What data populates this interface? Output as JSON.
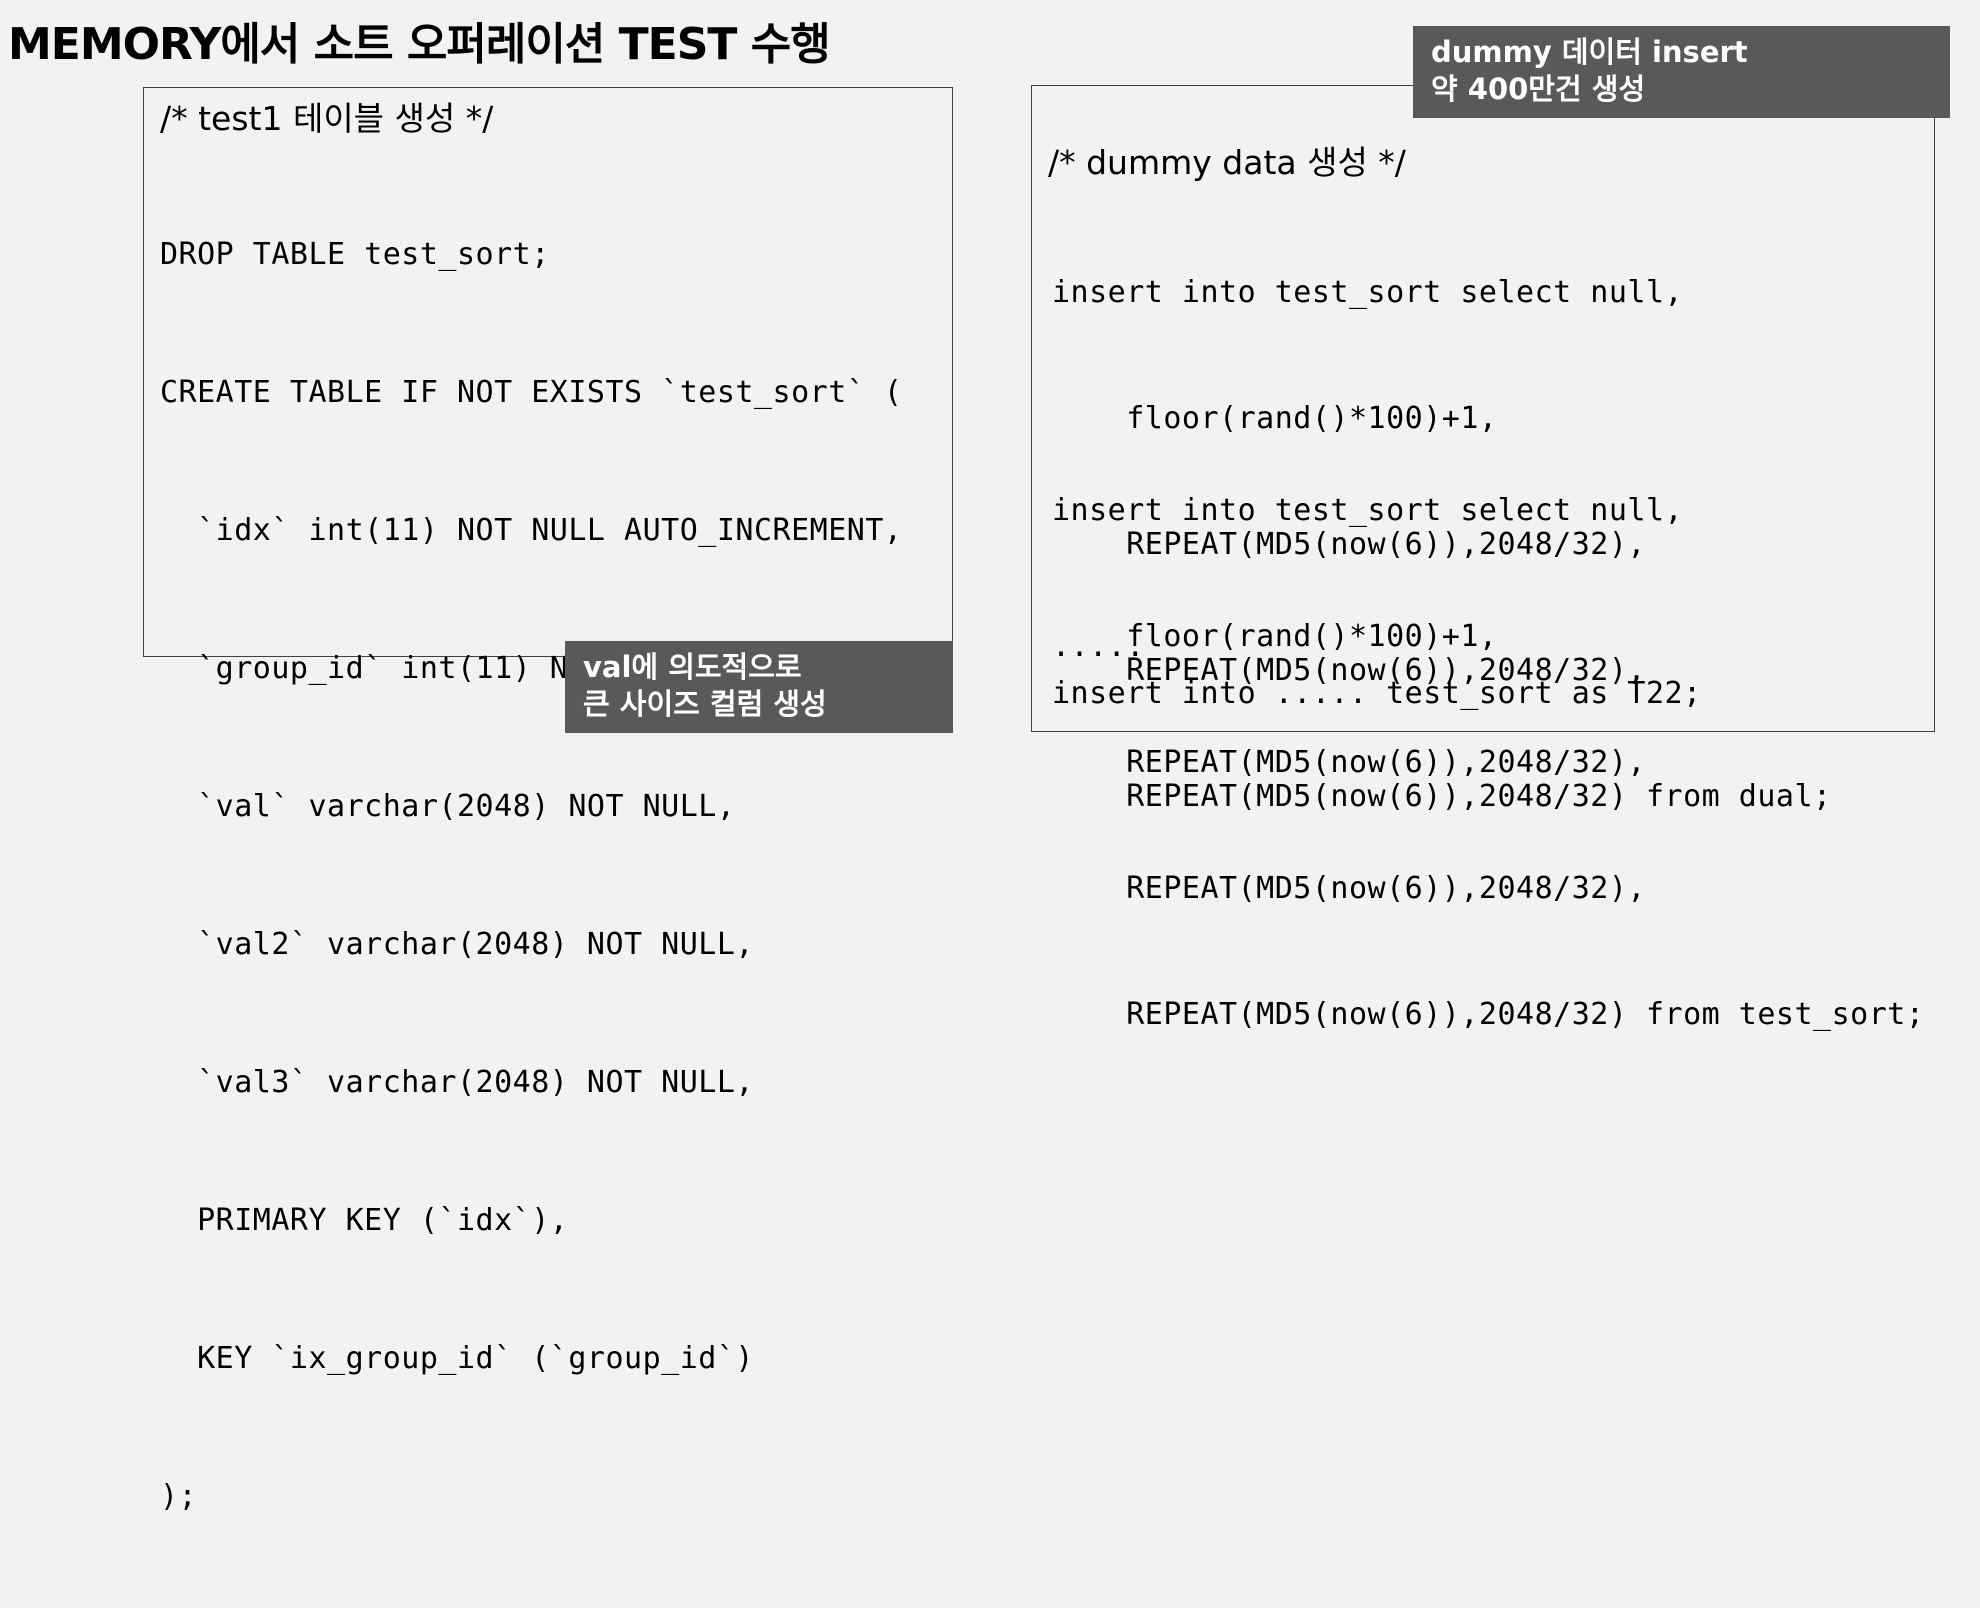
{
  "title": "MEMORY에서 소트 오퍼레이션 TEST 수행",
  "left": {
    "comment": "/* test1 테이블 생성 */",
    "lines": [
      "DROP TABLE test_sort;",
      "CREATE TABLE IF NOT EXISTS `test_sort` (",
      "  `idx` int(11) NOT NULL AUTO_INCREMENT,",
      "  `group_id` int(11) NOT NULL,",
      "  `val` varchar(2048) NOT NULL,",
      "  `val2` varchar(2048) NOT NULL,",
      "  `val3` varchar(2048) NOT NULL,",
      "  PRIMARY KEY (`idx`),",
      "  KEY `ix_group_id` (`group_id`)",
      ");"
    ],
    "callout": [
      "val에 의도적으로",
      "큰 사이즈 컬럼 생성"
    ]
  },
  "right": {
    "callout": [
      "dummy 데이터 insert",
      "약 400만건 생성"
    ],
    "comment": "/* dummy data 생성 */",
    "block1": [
      "insert into test_sort select null,",
      "    floor(rand()*100)+1,",
      "    REPEAT(MD5(now(6)),2048/32),",
      "    REPEAT(MD5(now(6)),2048/32),",
      "    REPEAT(MD5(now(6)),2048/32) from dual;"
    ],
    "block2": [
      "insert into test_sort select null,",
      "    floor(rand()*100)+1,",
      "    REPEAT(MD5(now(6)),2048/32),",
      "    REPEAT(MD5(now(6)),2048/32),",
      "    REPEAT(MD5(now(6)),2048/32) from test_sort;"
    ],
    "ellipsis": ".....",
    "last": "insert into ..... test_sort as T22;"
  }
}
